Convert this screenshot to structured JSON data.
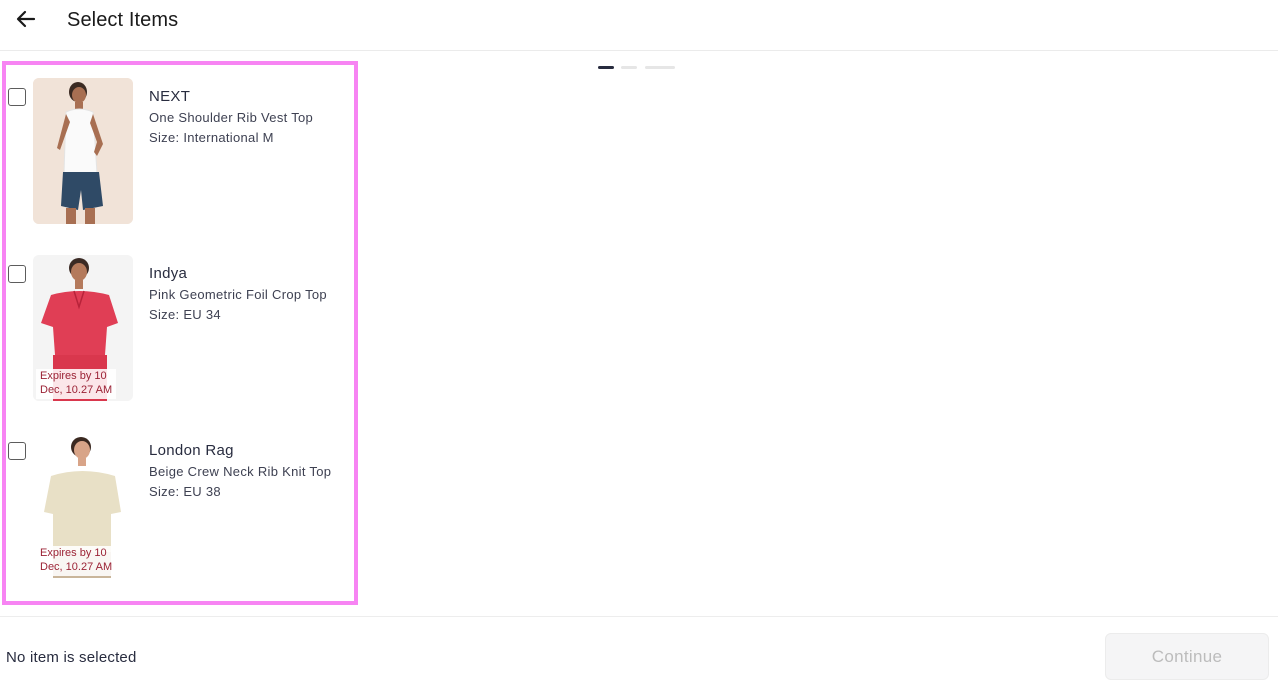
{
  "header": {
    "back_icon": "arrow-left-icon",
    "title": "Select Items"
  },
  "stepper": {
    "steps": 3,
    "current": 1
  },
  "items": [
    {
      "brand": "NEXT",
      "name": "One Shoulder Rib Vest Top",
      "size": "Size: International M",
      "checked": false,
      "expires": ""
    },
    {
      "brand": "Indya",
      "name": "Pink Geometric Foil Crop Top",
      "size": "Size: EU 34",
      "checked": false,
      "expires": "Expires by 10 Dec, 10.27 AM"
    },
    {
      "brand": "London Rag",
      "name": "Beige Crew Neck Rib Knit Top",
      "size": "Size: EU 38",
      "checked": false,
      "expires": "Expires by 10 Dec, 10.27 AM"
    }
  ],
  "footer": {
    "status": "No item is selected",
    "continue_label": "Continue"
  },
  "colors": {
    "highlight": "#f784f3",
    "expires_text": "#9b2235",
    "button_disabled_bg": "#f5f5f6",
    "button_disabled_text": "#bcbcbc"
  }
}
